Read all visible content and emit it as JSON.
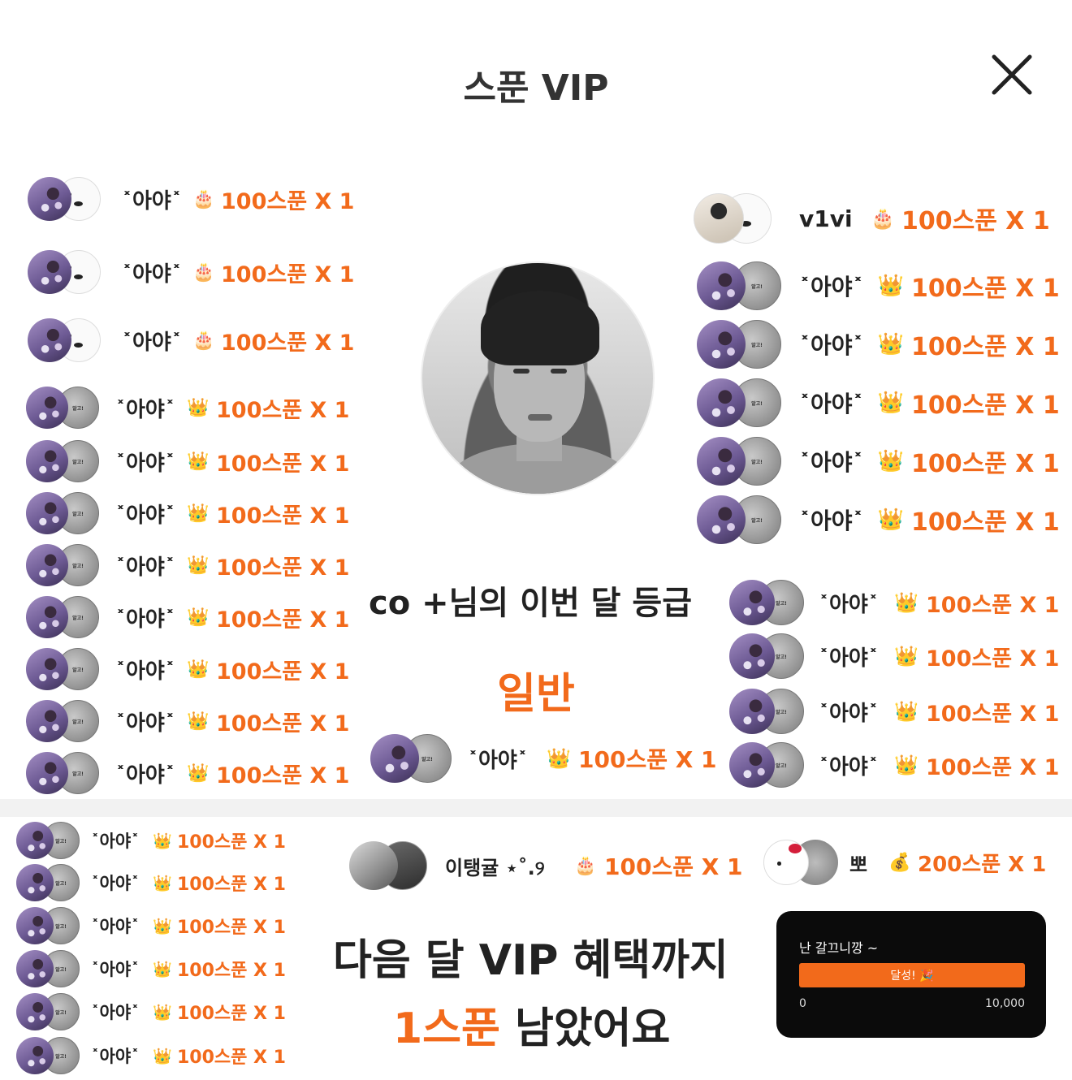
{
  "header": {
    "title": "스푼 VIP",
    "close_icon": "close-icon"
  },
  "profile": {
    "avatar": "profile-avatar"
  },
  "grade": {
    "label": "co +님의 이번 달 등급",
    "value": "일반"
  },
  "benefit": {
    "line1": "다음 달 VIP 혜택까지",
    "amount": "1스푼",
    "suffix": " 남았어요"
  },
  "goal": {
    "title": "난 갈끄니깡 ~",
    "bar_label": "달성! 🎉",
    "min": "0",
    "max": "10,000",
    "progress_fraction": 1.0
  },
  "accent_color": "#f26a1b",
  "gifts": {
    "left_col": [
      {
        "nick": "˟아야˟",
        "gift_icon": "cake-icon",
        "amount": "100스푼 X 1"
      },
      {
        "nick": "˟아야˟",
        "gift_icon": "cake-icon",
        "amount": "100스푼 X 1"
      },
      {
        "nick": "˟아야˟",
        "gift_icon": "cake-icon",
        "amount": "100스푼 X 1"
      },
      {
        "nick": "˟아야˟",
        "gift_icon": "crown-icon",
        "amount": "100스푼 X 1"
      },
      {
        "nick": "˟아야˟",
        "gift_icon": "crown-icon",
        "amount": "100스푼 X 1"
      },
      {
        "nick": "˟아야˟",
        "gift_icon": "crown-icon",
        "amount": "100스푼 X 1"
      },
      {
        "nick": "˟아야˟",
        "gift_icon": "crown-icon",
        "amount": "100스푼 X 1"
      },
      {
        "nick": "˟아야˟",
        "gift_icon": "crown-icon",
        "amount": "100스푼 X 1"
      },
      {
        "nick": "˟아야˟",
        "gift_icon": "crown-icon",
        "amount": "100스푼 X 1"
      },
      {
        "nick": "˟아야˟",
        "gift_icon": "crown-icon",
        "amount": "100스푼 X 1"
      },
      {
        "nick": "˟아야˟",
        "gift_icon": "crown-icon",
        "amount": "100스푼 X 1"
      }
    ],
    "right_top": [
      {
        "nick": "v1vi",
        "gift_icon": "cake-icon",
        "amount": "100스푼 X 1"
      },
      {
        "nick": "˟아야˟",
        "gift_icon": "crown-icon",
        "amount": "100스푼 X 1"
      },
      {
        "nick": "˟아야˟",
        "gift_icon": "crown-icon",
        "amount": "100스푼 X 1"
      },
      {
        "nick": "˟아야˟",
        "gift_icon": "crown-icon",
        "amount": "100스푼 X 1"
      },
      {
        "nick": "˟아야˟",
        "gift_icon": "crown-icon",
        "amount": "100스푼 X 1"
      },
      {
        "nick": "˟아야˟",
        "gift_icon": "crown-icon",
        "amount": "100스푼 X 1"
      }
    ],
    "right_mid": [
      {
        "nick": "˟아야˟",
        "gift_icon": "crown-icon",
        "amount": "100스푼 X 1"
      },
      {
        "nick": "˟아야˟",
        "gift_icon": "crown-icon",
        "amount": "100스푼 X 1"
      },
      {
        "nick": "˟아야˟",
        "gift_icon": "crown-icon",
        "amount": "100스푼 X 1"
      },
      {
        "nick": "˟아야˟",
        "gift_icon": "crown-icon",
        "amount": "100스푼 X 1"
      }
    ],
    "center": {
      "nick": "˟아야˟",
      "gift_icon": "crown-icon",
      "amount": "100스푼 X 1"
    },
    "bottom_left": [
      {
        "nick": "˟아야˟",
        "gift_icon": "crown-icon",
        "amount": "100스푼 X 1"
      },
      {
        "nick": "˟아야˟",
        "gift_icon": "crown-icon",
        "amount": "100스푼 X 1"
      },
      {
        "nick": "˟아야˟",
        "gift_icon": "crown-icon",
        "amount": "100스푼 X 1"
      },
      {
        "nick": "˟아야˟",
        "gift_icon": "crown-icon",
        "amount": "100스푼 X 1"
      },
      {
        "nick": "˟아야˟",
        "gift_icon": "crown-icon",
        "amount": "100스푼 X 1"
      },
      {
        "nick": "˟아야˟",
        "gift_icon": "crown-icon",
        "amount": "100스푼 X 1"
      }
    ],
    "bottom_mid": {
      "nick": "이탱귤 ⋆˚.୨",
      "gift_icon": "cake-icon",
      "amount": "100스푼 X 1"
    },
    "bottom_right": {
      "nick": "뽀",
      "gift_icon": "money-bag-icon",
      "amount": "200스푼 X 1"
    }
  }
}
